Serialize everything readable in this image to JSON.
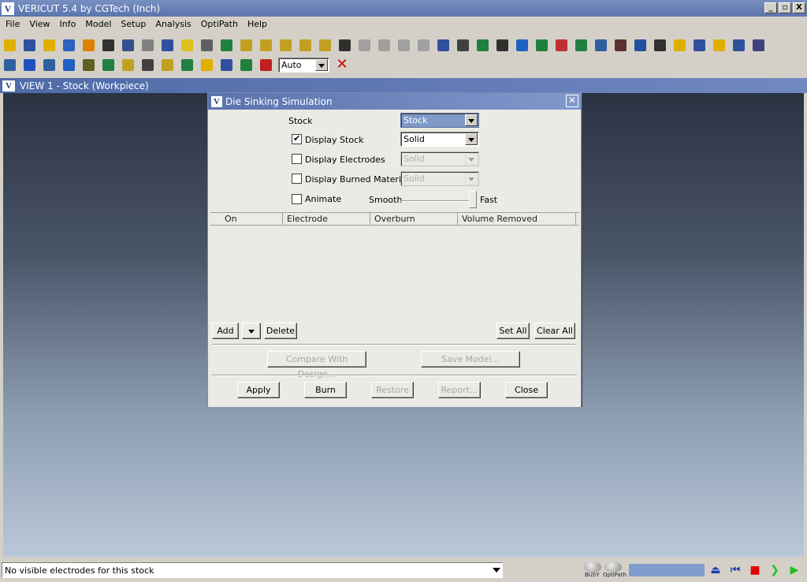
{
  "window": {
    "title": "VERICUT 5.4 by CGTech (Inch)",
    "icon_text": "V",
    "minimize": "_",
    "maximize": "▫",
    "close": "X"
  },
  "menu": [
    "File",
    "View",
    "Info",
    "Model",
    "Setup",
    "Analysis",
    "OptiPath",
    "Help"
  ],
  "toolbar1": [
    {
      "name": "open-session-icon",
      "color": "#e0b000"
    },
    {
      "name": "save-session-icon",
      "color": "#3050a0"
    },
    {
      "name": "open-folder-icon",
      "color": "#e0b000"
    },
    {
      "name": "nc-program-icon",
      "color": "#3060c0"
    },
    {
      "name": "color-icon",
      "color": "#e08000"
    },
    {
      "name": "machine-icon",
      "color": "#303030"
    },
    {
      "name": "tool-manager-icon",
      "color": "#305090"
    },
    {
      "name": "print-icon",
      "color": "#808080"
    },
    {
      "name": "save-icon",
      "color": "#3050a0"
    },
    {
      "name": "stock-icon",
      "color": "#e0c020"
    },
    {
      "name": "cutter-icon",
      "color": "#606060"
    },
    {
      "name": "model-tree-icon",
      "color": "#208040"
    },
    {
      "name": "fixture-icon",
      "color": "#c0a020"
    },
    {
      "name": "x-axis-icon",
      "color": "#c0a020"
    },
    {
      "name": "y-axis-icon",
      "color": "#c0a020"
    },
    {
      "name": "rotate-icon",
      "color": "#c0a020"
    },
    {
      "name": "xyz-icon",
      "color": "#c0a020"
    },
    {
      "name": "pan-icon",
      "color": "#303030"
    },
    {
      "name": "dynamic-rotate-icon",
      "color": "#a0a0a0"
    },
    {
      "name": "zoom-icon",
      "color": "#a0a0a0"
    },
    {
      "name": "zoom-in-icon",
      "color": "#a0a0a0"
    },
    {
      "name": "zoom-out-icon",
      "color": "#a0a0a0"
    },
    {
      "name": "fit-icon",
      "color": "#3050a0"
    },
    {
      "name": "eye-icon",
      "color": "#404040"
    },
    {
      "name": "reverse-icon",
      "color": "#208040"
    },
    {
      "name": "reset-icon",
      "color": "#303030"
    },
    {
      "name": "cube-icon",
      "color": "#2060c0"
    },
    {
      "name": "axes-icon",
      "color": "#208040"
    },
    {
      "name": "measure-icon",
      "color": "#c03030"
    },
    {
      "name": "xcaliper-icon",
      "color": "#208040"
    },
    {
      "name": "compare-icon",
      "color": "#3060a0"
    },
    {
      "name": "arrow-icon",
      "color": "#603030"
    },
    {
      "name": "probe-icon",
      "color": "#2050a0"
    },
    {
      "name": "ruler-icon",
      "color": "#303030"
    },
    {
      "name": "folder-icon",
      "color": "#e0b000"
    },
    {
      "name": "save-as-icon",
      "color": "#3050a0"
    },
    {
      "name": "open-icon",
      "color": "#e0b000"
    },
    {
      "name": "save-model-icon",
      "color": "#3050a0"
    },
    {
      "name": "hatch-icon",
      "color": "#404080"
    }
  ],
  "toolbar2": [
    {
      "name": "layout-icon",
      "color": "#3060a0"
    },
    {
      "name": "info-icon",
      "color": "#2050c0"
    },
    {
      "name": "report-icon",
      "color": "#3060a0"
    },
    {
      "name": "machine-settings-icon",
      "color": "#2060c0"
    },
    {
      "name": "component-tree-icon",
      "color": "#606020"
    },
    {
      "name": "project-icon",
      "color": "#208040"
    },
    {
      "name": "layers-icon",
      "color": "#c0a020"
    },
    {
      "name": "diamond-icon",
      "color": "#404040"
    },
    {
      "name": "optipath-icon",
      "color": "#c0a020"
    },
    {
      "name": "tool-icon",
      "color": "#208040"
    },
    {
      "name": "flash-icon",
      "color": "#e0b000"
    },
    {
      "name": "vericut-icon",
      "color": "#3050a0"
    },
    {
      "name": "plus-icon",
      "color": "#208040"
    },
    {
      "name": "stop-icon",
      "color": "#c02020"
    }
  ],
  "toolbar2_combo": "Auto",
  "toolbar2_cancel": "✕",
  "view": {
    "icon_text": "V",
    "title": "VIEW 1 - Stock (Workpiece)"
  },
  "dialog": {
    "icon_text": "V",
    "title": "Die Sinking Simulation",
    "close": "✕",
    "stock_label": "Stock",
    "stock_value": "Stock",
    "display_stock": {
      "label": "Display Stock",
      "checked": true,
      "value": "Solid"
    },
    "display_electrodes": {
      "label": "Display Electrodes",
      "checked": false,
      "value": "Solid"
    },
    "display_burned": {
      "label": "Display Burned Material",
      "checked": false,
      "value": "Solid"
    },
    "animate": {
      "label": "Animate",
      "checked": false
    },
    "slider": {
      "left_label": "Smooth",
      "right_label": "Fast",
      "position_pct": 100
    },
    "columns": [
      "On",
      "Electrode",
      "Overburn",
      "Volume Removed"
    ],
    "buttons": {
      "add": "Add",
      "delete": "Delete",
      "set_all": "Set All",
      "clear_all": "Clear All",
      "compare": "Compare With Design...",
      "save_model": "Save Model...",
      "apply": "Apply",
      "burn": "Burn",
      "restore": "Restore",
      "report": "Report...",
      "close": "Close"
    }
  },
  "status": {
    "message": "No visible electrodes for this stock",
    "busy": "BUSY",
    "optipath": "OptiPath",
    "progress_color": "#7f9ccd"
  }
}
